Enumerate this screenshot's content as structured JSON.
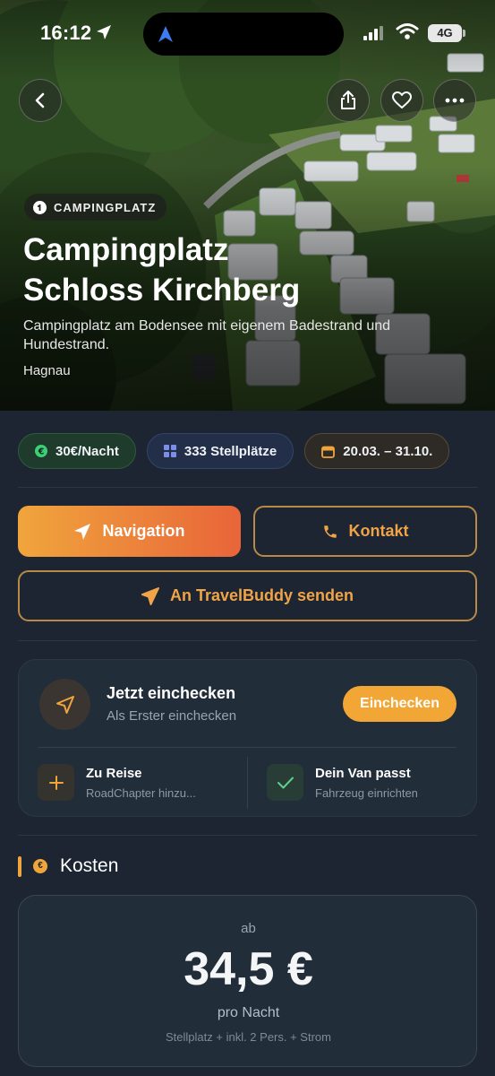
{
  "status_bar": {
    "time": "16:12",
    "network": "4G"
  },
  "hero": {
    "tag": "CAMPINGPLATZ",
    "title_line1": "Campingplatz",
    "title_line2": "Schloss Kirchberg",
    "description": "Campingplatz am Bodensee mit eigenem Badestrand und Hundestrand.",
    "location": "Hagnau"
  },
  "chips": {
    "price": "30€/Nacht",
    "spots": "333 Stellplätze",
    "season": "20.03. – 31.10."
  },
  "actions": {
    "navigation": "Navigation",
    "contact": "Kontakt",
    "travelbuddy": "An TravelBuddy senden"
  },
  "checkin": {
    "title": "Jetzt einchecken",
    "subtitle": "Als Erster einchecken",
    "button": "Einchecken",
    "trip_title": "Zu Reise",
    "trip_sub": "RoadChapter hinzu...",
    "van_title": "Dein Van passt",
    "van_sub": "Fahrzeug einrichten"
  },
  "costs": {
    "section_title": "Kosten",
    "coin_symbol": "€",
    "prefix": "ab",
    "value": "34,5 €",
    "per": "pro Nacht",
    "note": "Stellplatz + inkl. 2 Pers. + Strom"
  },
  "colors": {
    "accent": "#f0a53c",
    "accent_gradient_end": "#e8653a",
    "background": "#1c2531",
    "card": "#222d3a"
  },
  "icons": [
    "location-arrow-icon",
    "back-chevron-icon",
    "share-icon",
    "heart-icon",
    "more-icon",
    "info-icon",
    "euro-icon",
    "grid-icon",
    "calendar-icon",
    "navigation-arrow-icon",
    "phone-icon",
    "send-icon",
    "plus-icon",
    "check-icon"
  ]
}
